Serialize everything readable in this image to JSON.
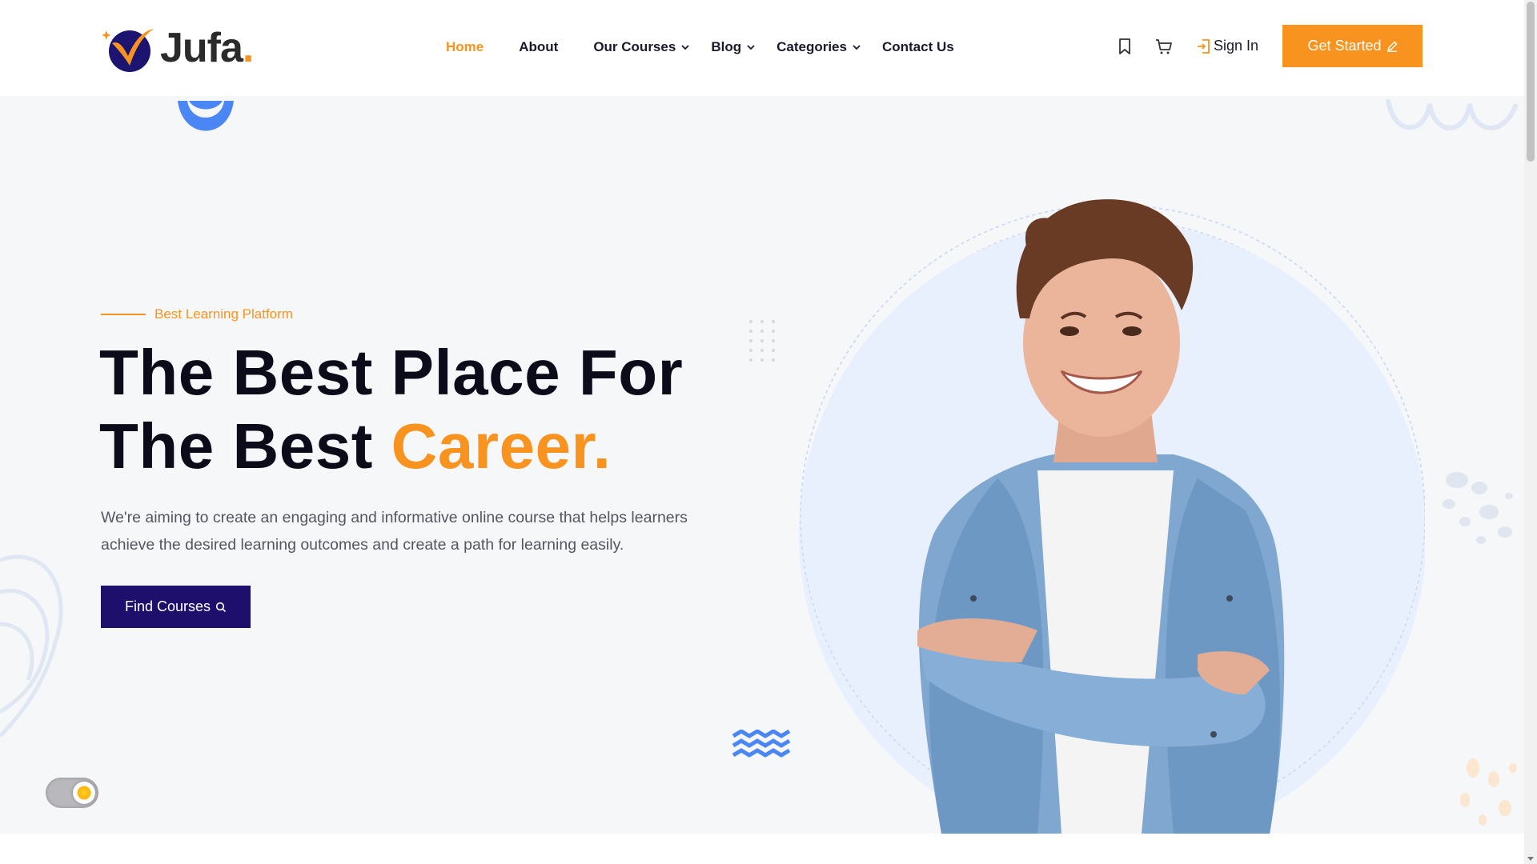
{
  "header": {
    "logo_text": "Jufa",
    "logo_dot": ".",
    "nav": [
      {
        "label": "Home",
        "active": true
      },
      {
        "label": "About"
      },
      {
        "label": "Our Courses",
        "has_dropdown": true
      },
      {
        "label": "Blog",
        "has_dropdown": true
      },
      {
        "label": "Categories",
        "has_dropdown": true
      },
      {
        "label": "Contact Us"
      }
    ],
    "icons": [
      "bookmark-icon",
      "cart-icon"
    ],
    "sign_in_label": "Sign In",
    "get_started_label": "Get Started"
  },
  "hero": {
    "tagline": "Best Learning Platform",
    "headline_line1": "The Best Place For",
    "headline_line2_prefix": "The Best ",
    "headline_accent": "Career.",
    "description": "We're aiming to create an engaging and informative online course that helps learners achieve the desired learning outcomes and create a path for learning easily.",
    "find_courses_label": "Find Courses"
  },
  "colors": {
    "accent": "#f7931e",
    "primary": "#1d0f6b",
    "hero_bg": "#f6f7f9",
    "decor_blue": "#4b86f5"
  }
}
